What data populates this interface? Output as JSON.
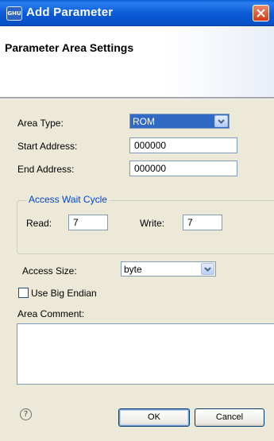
{
  "window": {
    "title": "Add Parameter",
    "close_icon": "close-icon",
    "app_icon_text": "GHU"
  },
  "header": {
    "title": "Parameter Area Settings"
  },
  "form": {
    "area_type_label": "Area Type:",
    "area_type_value": "ROM",
    "start_address_label": "Start Address:",
    "start_address_value": "000000",
    "end_address_label": "End Address:",
    "end_address_value": "000000",
    "access_wait_cycle": {
      "title": "Access Wait Cycle",
      "read_label": "Read:",
      "read_value": "7",
      "write_label": "Write:",
      "write_value": "7"
    },
    "access_size_label": "Access Size:",
    "access_size_value": "byte",
    "big_endian_label": "Use Big Endian",
    "big_endian_checked": false,
    "area_comment_label": "Area Comment:",
    "area_comment_value": ""
  },
  "footer": {
    "help_symbol": "?",
    "ok_label": "OK",
    "cancel_label": "Cancel"
  },
  "colors": {
    "titlebar": "#0b59d6",
    "selection": "#316ac5",
    "group_title": "#0046d5",
    "dialog_bg": "#ece9d8"
  }
}
